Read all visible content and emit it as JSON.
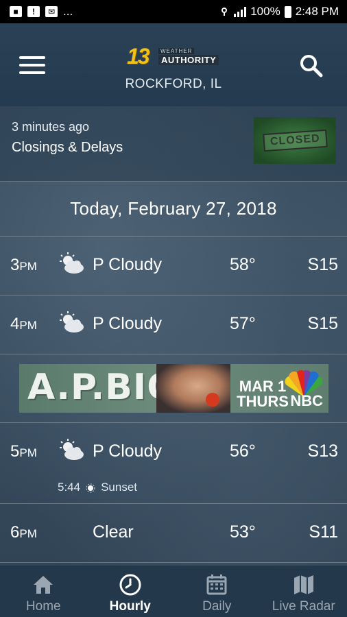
{
  "status_bar": {
    "left_ellipsis": "...",
    "battery": "100%",
    "time": "2:48 PM"
  },
  "header": {
    "logo_number": "13",
    "logo_top": "WEATHER",
    "logo_bottom": "AUTHORITY",
    "location": "ROCKFORD, IL"
  },
  "news": {
    "time_ago": "3 minutes ago",
    "title": "Closings & Delays",
    "thumb_text": "CLOSED"
  },
  "date_header": "Today, February 27, 2018",
  "hours": [
    {
      "hour": "3",
      "ampm": "PM",
      "icon": "partly-cloudy-icon",
      "condition": "P Cloudy",
      "temp": "58°",
      "wind": "S15"
    },
    {
      "hour": "4",
      "ampm": "PM",
      "icon": "partly-cloudy-icon",
      "condition": "P Cloudy",
      "temp": "57°",
      "wind": "S15"
    },
    {
      "hour": "5",
      "ampm": "PM",
      "icon": "partly-cloudy-icon",
      "condition": "P Cloudy",
      "temp": "56°",
      "wind": "S13",
      "sunset_time": "5:44",
      "sunset_label": "Sunset"
    },
    {
      "hour": "6",
      "ampm": "PM",
      "icon": "moon-icon",
      "condition": "Clear",
      "temp": "53°",
      "wind": "S11"
    }
  ],
  "ad": {
    "title": "A.P.BIO",
    "date_line1": "MAR 1",
    "date_line2": "THURS",
    "network": "NBC"
  },
  "nav": [
    {
      "label": "Home",
      "icon": "home-icon",
      "active": false
    },
    {
      "label": "Hourly",
      "icon": "clock-icon",
      "active": true
    },
    {
      "label": "Daily",
      "icon": "calendar-icon",
      "active": false
    },
    {
      "label": "Live Radar",
      "icon": "map-icon",
      "active": false
    }
  ],
  "colors": {
    "logo_yellow": "#f2c21b",
    "header_bg": "#2b4156",
    "nav_bg": "#24384b",
    "nav_inactive": "#9aa7b3"
  }
}
